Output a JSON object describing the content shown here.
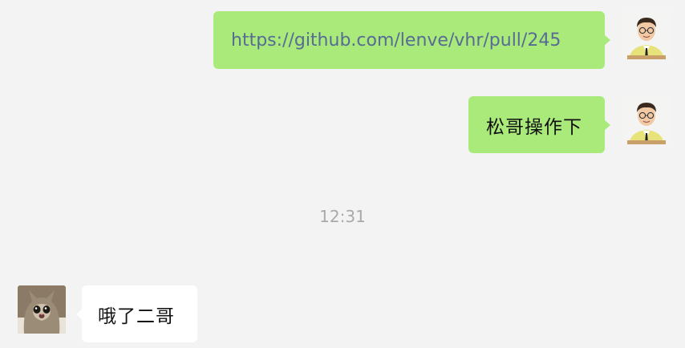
{
  "messages": [
    {
      "direction": "outgoing",
      "type": "link",
      "text": "https://github.com/lenve/vhr/pull/245",
      "avatar": "cartoon-man-avatar"
    },
    {
      "direction": "outgoing",
      "type": "text",
      "text": "松哥操作下",
      "avatar": "cartoon-man-avatar"
    },
    {
      "direction": "incoming",
      "type": "text",
      "text": "哦了二哥",
      "avatar": "cat-photo-avatar"
    }
  ],
  "timestamp": "12:31",
  "colors": {
    "background": "#f3f3f3",
    "outgoing_bubble": "#a9ea7a",
    "incoming_bubble": "#ffffff",
    "link": "#576b95",
    "timestamp": "#a9a9a9"
  }
}
